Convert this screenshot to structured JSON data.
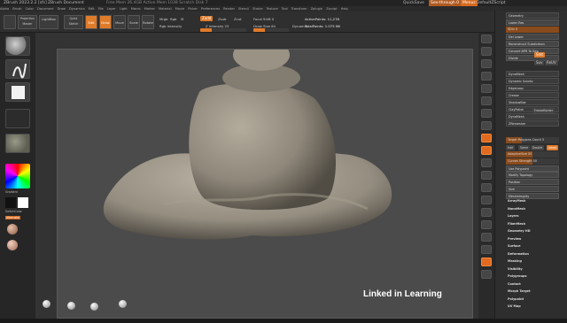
{
  "window": {
    "title_left": "ZBrush 2023.2.2 [sfs]",
    "title_doc": "ZBrush Document",
    "mem": "Free Mem 26.4GB  Active Mem 1038  Scratch Disk 7",
    "quicksave": "QuickSave",
    "seethrough": "See-through  0",
    "menus_label": "Menus",
    "defaultscript": "DefaultZScript"
  },
  "menubar": [
    "Alpha",
    "Brush",
    "Color",
    "Document",
    "Draw",
    "Dynamics",
    "Edit",
    "File",
    "Layer",
    "Light",
    "Macro",
    "Marker",
    "Material",
    "Movie",
    "Picker",
    "Preferences",
    "Render",
    "Stencil",
    "Stroke",
    "Texture",
    "Tool",
    "Transform",
    "Zplugin",
    "Zscript",
    "Help"
  ],
  "toolbar": {
    "lightbox_label": "LightBox",
    "projection_label": "Projection Master",
    "quicksketch_label": "Quick Sketch",
    "edit_label": "Edit",
    "draw_label": "Draw",
    "move_label": "Move",
    "scale_label": "Scale",
    "rotate_label": "Rotate",
    "mrgb_label": "Mrgb",
    "rgb_label": "Rgb",
    "m_label": "M",
    "zadd_label": "Zadd",
    "zsub_label": "Zsub",
    "zcut_label": "Zcut",
    "rgb_intensity_label": "Rgb Intensity",
    "z_intensity_label": "Z Intensity 25",
    "focal_label": "Focal Shift 0",
    "draw_size_label": "Draw Size 64",
    "dynamic_label": "Dynamic",
    "active_points": "ActivePoints: 11,278",
    "total_points": "TotalPoints: 1.075 Mil",
    "z_intensity_value": 0.25,
    "draw_size_value": 0.33
  },
  "left_shelf": {
    "thumbs": [
      "standard-brush",
      "stroke",
      "alpha",
      "texture",
      "material"
    ],
    "gradient_label": "Gradient",
    "switch_color_label": "SwitchColor",
    "alternate_label": "Alternate",
    "mat_labels": [
      "Skin_Shade4",
      "MatCap_Gray",
      "RS_Basic"
    ]
  },
  "right_panel": {
    "rows": [
      {
        "label": "Geometry",
        "type": "hdr"
      },
      {
        "label": "Lower Res",
        "type": "btn"
      },
      {
        "label": "SDiv 4",
        "type": "sl",
        "value": 1.0
      },
      {
        "label": "Del Lower",
        "type": "btn"
      },
      {
        "label": "Reconstruct Subdivision",
        "type": "btn"
      },
      {
        "label": "Convert BPR To Geo",
        "type": "btn"
      },
      {
        "label": "Divide",
        "type": "btn"
      },
      {
        "label": "DynaMesh",
        "type": "hdr"
      },
      {
        "label": "Dynamic Subdiv",
        "type": "hdr"
      },
      {
        "label": "EdgeLoop",
        "type": "hdr"
      },
      {
        "label": "Crease",
        "type": "hdr"
      },
      {
        "label": "ShadowBox",
        "type": "hdr"
      },
      {
        "label": "ClayPolish",
        "type": "hdr"
      },
      {
        "label": "DynaMesh",
        "type": "hdr"
      },
      {
        "label": "ZRemesher",
        "type": "hdr"
      },
      {
        "label": "Modify Topology",
        "type": "btn"
      },
      {
        "label": "Position",
        "type": "btn"
      },
      {
        "label": "Size",
        "type": "btn"
      },
      {
        "label": "MeshIntegrity",
        "type": "btn"
      }
    ],
    "lower_rows": [
      "ArrayMesh",
      "NanoMesh",
      "Layers",
      "FiberMesh",
      "Geometry HD",
      "Preview",
      "Surface",
      "Deformation",
      "Masking",
      "Visibility",
      "Polygroups",
      "Contact",
      "Morph Target",
      "Polypaint",
      "UV Map"
    ],
    "subd_value": "SDiv 4",
    "smt_label": "Smt",
    "suv_label": "Suv",
    "reuv_label": "ReUV",
    "zremesher_btn": "ZRemesher",
    "freeze_label": "FreezeBorder",
    "target_label": "Target Polygons Count 5",
    "half_label": "Half",
    "same_label": "Same",
    "double_label": "Double",
    "adapt_label": "Adapt",
    "adaptive_size": "AdaptiveSize 50",
    "curves_strength": "Curves Strength 50",
    "use_polypaint": "Use Polypaint"
  },
  "watermark": "Linked in Learning"
}
